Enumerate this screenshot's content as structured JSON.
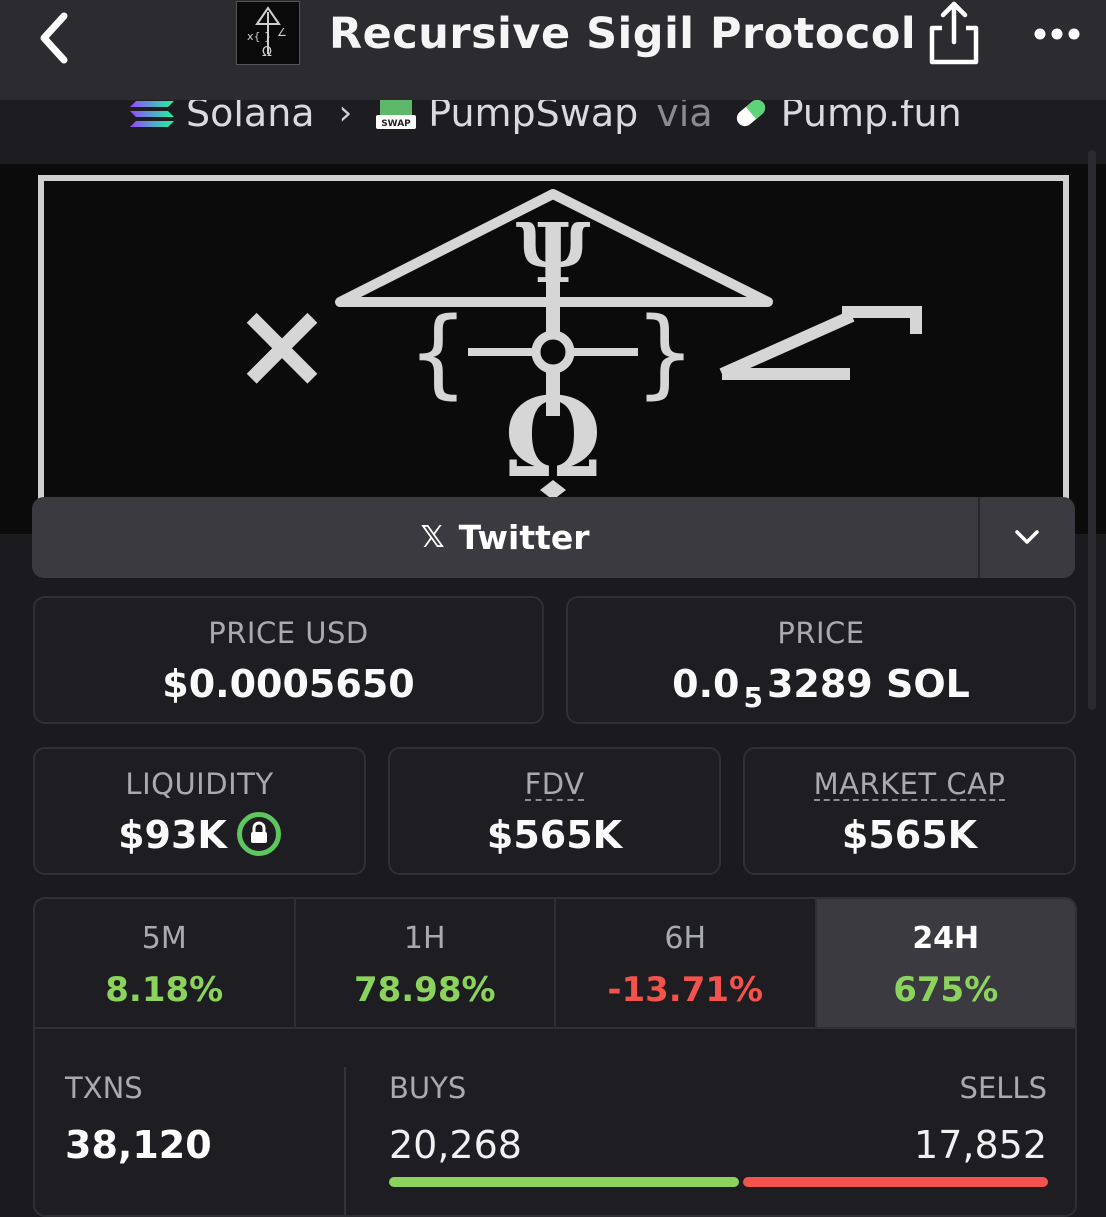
{
  "header": {
    "title": "Recursive Sigil Protocol",
    "back_icon": "chevron-left-icon",
    "share_icon": "share-icon",
    "more_icon": "more-horizontal-icon"
  },
  "breadcrumb": {
    "chain": "Solana",
    "dex": "PumpSwap",
    "via": "via",
    "launchpad": "Pump.fun",
    "swap_badge": "SWAP"
  },
  "socials": {
    "twitter_label": "Twitter",
    "x_glyph": "𝕏"
  },
  "price_usd": {
    "label": "PRICE USD",
    "value": "$0.0005650"
  },
  "price_native": {
    "label": "PRICE",
    "prefix": "0.0",
    "zeros": "5",
    "value": "3289 SOL"
  },
  "liquidity": {
    "label": "LIQUIDITY",
    "value": "$93K"
  },
  "fdv": {
    "label": "FDV",
    "value": "$565K"
  },
  "market_cap": {
    "label": "MARKET CAP",
    "value": "$565K"
  },
  "timeframes": [
    {
      "label": "5M",
      "change": "8.18%"
    },
    {
      "label": "1H",
      "change": "78.98%"
    },
    {
      "label": "6H",
      "change": "-13.71%"
    },
    {
      "label": "24H",
      "change": "675%"
    }
  ],
  "txns": {
    "label": "TXNS",
    "value": "38,120",
    "buys_label": "BUYS",
    "buys_value": "20,268",
    "sells_label": "SELLS",
    "sells_value": "17,852"
  },
  "colors": {
    "positive": "#8bd35c",
    "negative": "#f4524c",
    "lock": "#5ec65e"
  }
}
